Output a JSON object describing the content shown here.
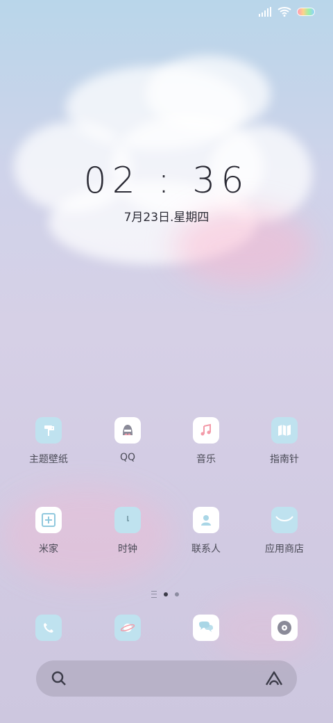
{
  "status": {
    "signal_icon": "signal-bars-icon",
    "wifi_icon": "wifi-icon",
    "battery_icon": "battery-icon"
  },
  "clock": {
    "time": "02 : 36",
    "date": "7月23日.星期四"
  },
  "home": {
    "apps": [
      {
        "label": "主题壁纸",
        "icon": "paint-roller-icon"
      },
      {
        "label": "QQ",
        "icon": "qq-penguin-icon"
      },
      {
        "label": "音乐",
        "icon": "music-note-icon"
      },
      {
        "label": "指南针",
        "icon": "map-icon"
      },
      {
        "label": "米家",
        "icon": "mijia-plus-icon"
      },
      {
        "label": "时钟",
        "icon": "clock-icon"
      },
      {
        "label": "联系人",
        "icon": "contact-person-icon"
      },
      {
        "label": "应用商店",
        "icon": "app-store-bag-icon"
      }
    ],
    "page_count": 2,
    "active_page": 1
  },
  "dock": [
    {
      "icon": "phone-icon"
    },
    {
      "icon": "browser-planet-icon"
    },
    {
      "icon": "messages-bubble-icon"
    },
    {
      "icon": "music-disc-icon"
    }
  ],
  "search": {
    "left_icon": "search-icon",
    "right_icon": "assistant-a-icon"
  }
}
